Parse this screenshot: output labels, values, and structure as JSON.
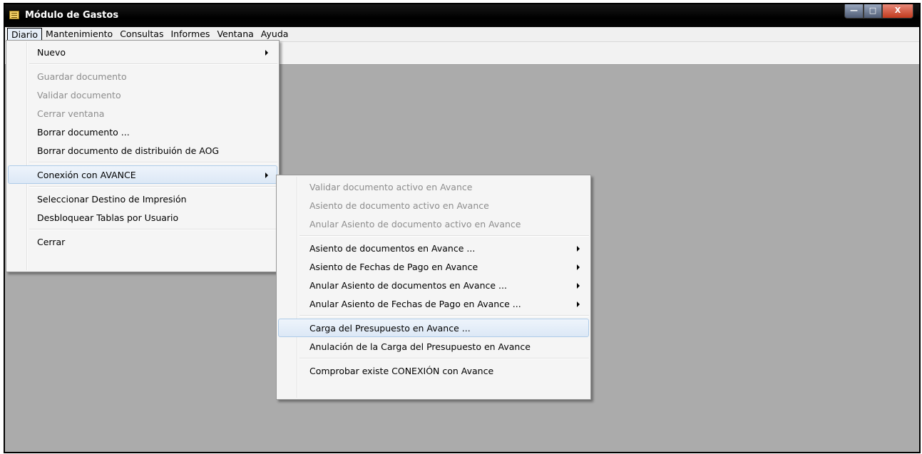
{
  "window": {
    "title": "Módulo de Gastos",
    "icon": "app-icon",
    "buttons": {
      "minimize": "—",
      "maximize": "□",
      "close": "X"
    }
  },
  "menubar": {
    "items": [
      "Diario",
      "Mantenimiento",
      "Consultas",
      "Informes",
      "Ventana",
      "Ayuda"
    ]
  },
  "diario_menu": {
    "nuevo": "Nuevo",
    "guardar": "Guardar documento",
    "validar": "Validar documento",
    "cerrar_ventana": "Cerrar ventana",
    "borrar": "Borrar documento ...",
    "borrar_aog": "Borrar documento de distribuión de AOG",
    "conexion": "Conexión con AVANCE",
    "destino": "Seleccionar Destino de Impresión",
    "desbloquear": "Desbloquear Tablas por Usuario",
    "cerrar": "Cerrar"
  },
  "avance_menu": {
    "validar_activo": "Validar documento activo en Avance",
    "asiento_activo": "Asiento de documento activo en Avance",
    "anular_asiento_activo": "Anular Asiento de documento activo en Avance",
    "asiento_docs": "Asiento de documentos en Avance ...",
    "asiento_fechas": "Asiento de Fechas de Pago en Avance",
    "anular_asiento_docs": "Anular Asiento de documentos en Avance ...",
    "anular_asiento_fechas": "Anular Asiento de Fechas de Pago en Avance ...",
    "carga_presupuesto": "Carga del Presupuesto en Avance ...",
    "anulacion_carga": "Anulación de la Carga del Presupuesto en Avance",
    "comprobar_conexion": "Comprobar existe CONEXIÓN con Avance"
  },
  "colors": {
    "workspace": "#ababab",
    "titlebar": "#000000",
    "menu_bg": "#f5f5f5",
    "disabled_text": "#8d8d8d",
    "highlight_border": "#aecbe8"
  }
}
